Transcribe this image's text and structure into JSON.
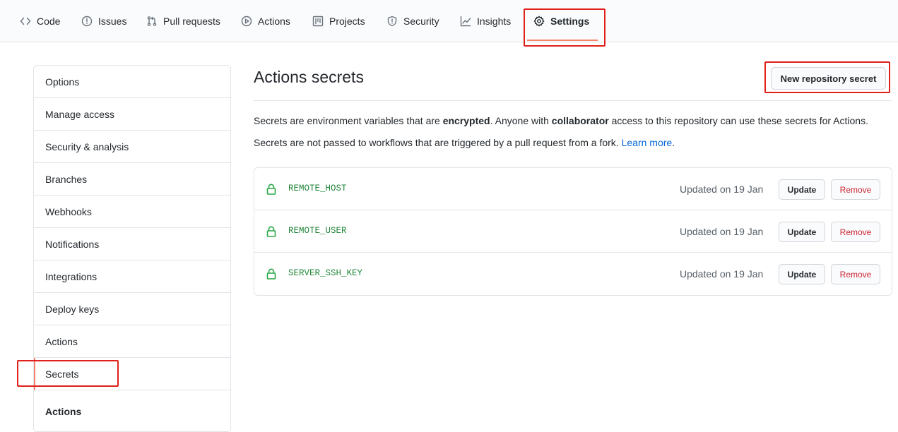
{
  "repo_nav": {
    "tabs": [
      {
        "label": "Code",
        "icon": "code-icon"
      },
      {
        "label": "Issues",
        "icon": "issue-opened-icon"
      },
      {
        "label": "Pull requests",
        "icon": "git-pull-request-icon"
      },
      {
        "label": "Actions",
        "icon": "play-icon"
      },
      {
        "label": "Projects",
        "icon": "project-icon"
      },
      {
        "label": "Security",
        "icon": "shield-icon"
      },
      {
        "label": "Insights",
        "icon": "graph-icon"
      },
      {
        "label": "Settings",
        "icon": "gear-icon",
        "selected": true
      }
    ]
  },
  "sidebar": {
    "items": [
      {
        "label": "Options"
      },
      {
        "label": "Manage access"
      },
      {
        "label": "Security & analysis"
      },
      {
        "label": "Branches"
      },
      {
        "label": "Webhooks"
      },
      {
        "label": "Notifications"
      },
      {
        "label": "Integrations"
      },
      {
        "label": "Deploy keys"
      },
      {
        "label": "Actions"
      },
      {
        "label": "Secrets",
        "selected": true
      }
    ],
    "section_heading": "Actions"
  },
  "main": {
    "title": "Actions secrets",
    "new_secret_button": "New repository secret",
    "description_line1": {
      "part1": "Secrets are environment variables that are ",
      "bold1": "encrypted",
      "part2": ". Anyone with ",
      "bold2": "collaborator",
      "part3": " access to this repository can use these secrets for Actions."
    },
    "description_line2": {
      "text": "Secrets are not passed to workflows that are triggered by a pull request from a fork. ",
      "link": "Learn more",
      "tail": "."
    },
    "secrets": [
      {
        "name": "REMOTE_HOST",
        "updated": "Updated on 19 Jan",
        "update_label": "Update",
        "remove_label": "Remove"
      },
      {
        "name": "REMOTE_USER",
        "updated": "Updated on 19 Jan",
        "update_label": "Update",
        "remove_label": "Remove"
      },
      {
        "name": "SERVER_SSH_KEY",
        "updated": "Updated on 19 Jan",
        "update_label": "Update",
        "remove_label": "Remove"
      }
    ]
  },
  "colors": {
    "accent_underline": "#f9826c",
    "highlight_annotation": "#e0201a",
    "secret_name": "#22863a",
    "remove_text": "#cb2431",
    "link": "#0366d6"
  }
}
